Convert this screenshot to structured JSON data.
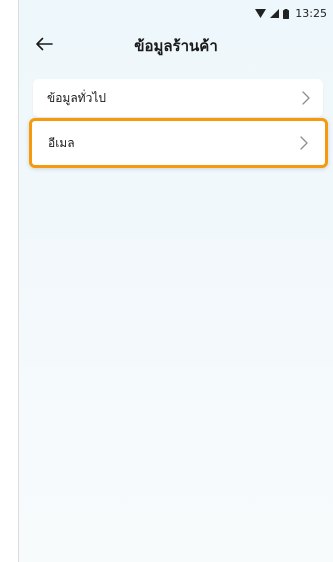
{
  "status_bar": {
    "time": "13:25",
    "icons": [
      "wifi-icon",
      "signal-icon",
      "battery-icon"
    ]
  },
  "app_bar": {
    "title": "ข้อมูลร้านค้า",
    "back_icon": "arrow-left-icon"
  },
  "menu_items": [
    {
      "label": "ข้อมูลทั่วไป",
      "icon": "chevron-right-icon"
    },
    {
      "label": "อีเมล",
      "icon": "chevron-right-icon"
    }
  ],
  "colors": {
    "highlight_border": "#f59a0c",
    "background_top": "#eef7fb",
    "background_bottom": "#f8fbfc"
  }
}
